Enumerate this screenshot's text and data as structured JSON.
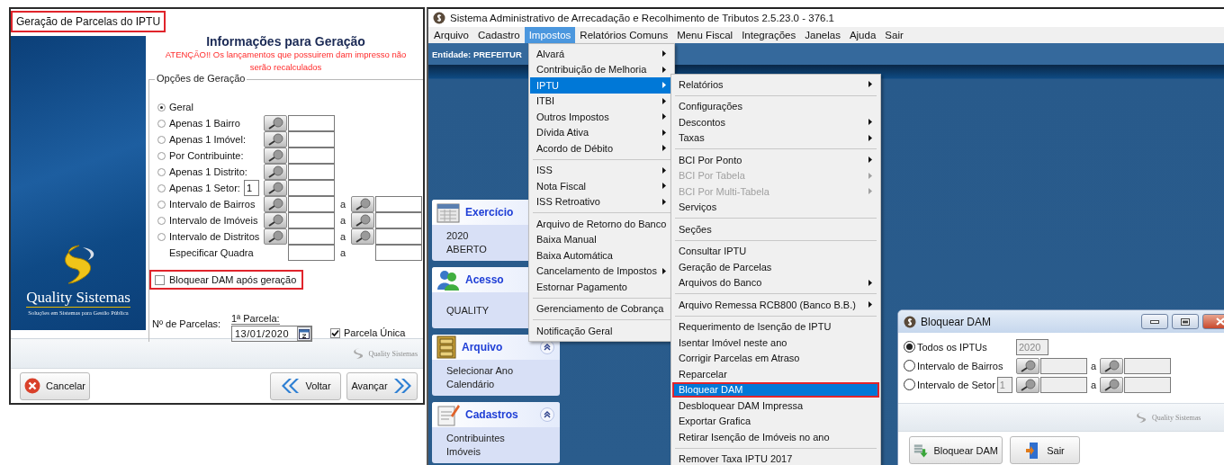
{
  "form_window": {
    "title": "Geração de Parcelas do IPTU",
    "title_annotated": true,
    "brand": "Quality Sistemas",
    "brand_tagline": "Soluções em Sistemas para Gestão Pública",
    "heading": "Informações para Geração",
    "warning": "ATENÇÃO!! Os lançamentos que possuirem dam impresso não serão recalculados",
    "group_title": "Opções de Geração",
    "options": [
      {
        "kind": "plain",
        "label": "Geral",
        "selected": true
      },
      {
        "kind": "single",
        "label": "Apenas 1 Bairro",
        "selected": false
      },
      {
        "kind": "single",
        "label": "Apenas 1 Imóvel:",
        "selected": false
      },
      {
        "kind": "single",
        "label": "Por Contribuinte:",
        "selected": false
      },
      {
        "kind": "single",
        "label": "Apenas 1 Distrito:",
        "selected": false
      },
      {
        "kind": "single",
        "label": "Apenas 1 Setor:",
        "selected": false,
        "prefix": "1"
      },
      {
        "kind": "range",
        "label": "Intervalo de Bairros",
        "selected": false,
        "separator": "a"
      },
      {
        "kind": "range",
        "label": "Intervalo de Imóveis",
        "selected": false,
        "separator": "a"
      },
      {
        "kind": "range",
        "label": "Intervalo de Distritos",
        "selected": false,
        "separator": "a"
      },
      {
        "kind": "fields",
        "label": "Especificar Quadra",
        "separator": "a"
      }
    ],
    "block_option": {
      "label": "Bloquear DAM após geração",
      "checked": false,
      "annotated": true
    },
    "installments_label": "Nº de Parcelas:",
    "first_installment_label": "1ª Parcela:",
    "first_installment_date": "13/01/2020",
    "single_installment": {
      "label": "Parcela Única",
      "checked": true
    },
    "footer_brand": "Quality Sistemas",
    "buttons": [
      {
        "kind": "cancel",
        "label": "Cancelar"
      },
      {
        "kind": "back",
        "label": "Voltar"
      },
      {
        "kind": "next",
        "label": "Avançar"
      }
    ]
  },
  "main_window": {
    "title": "Sistema Administrativo de Arrecadação e Recolhimento de Tributos 2.5.23.0 - 376.1",
    "menu": [
      {
        "label": "Arquivo",
        "selected": false
      },
      {
        "label": "Cadastro",
        "selected": false
      },
      {
        "label": "Impostos",
        "selected": true
      },
      {
        "label": "Relatórios Comuns",
        "selected": false
      },
      {
        "label": "Menu Fiscal",
        "selected": false
      },
      {
        "label": "Integrações",
        "selected": false
      },
      {
        "label": "Janelas",
        "selected": false
      },
      {
        "label": "Ajuda",
        "selected": false
      },
      {
        "label": "Sair",
        "selected": false
      }
    ],
    "entity": "Entidade: PREFEITUR",
    "side_panels": [
      {
        "kind": "calendar",
        "title": "Exercício",
        "lines": [
          "2020",
          "ABERTO"
        ]
      },
      {
        "kind": "user",
        "title": "Acesso",
        "lines": [
          "QUALITY"
        ]
      },
      {
        "kind": "cabinet",
        "title": "Arquivo",
        "collapse_button": true,
        "lines": [
          "Selecionar Ano",
          "Calendário"
        ]
      },
      {
        "kind": "notepad",
        "title": "Cadastros",
        "collapse_button": true,
        "lines": [
          "Contribuintes",
          "Imóveis"
        ]
      }
    ],
    "taxes_menu": [
      {
        "kind": "item",
        "label": "Alvará",
        "submenu": true,
        "selected": false
      },
      {
        "kind": "item",
        "label": "Contribuição de Melhoria",
        "submenu": true,
        "selected": false
      },
      {
        "kind": "item",
        "label": "IPTU",
        "submenu": true,
        "selected": true
      },
      {
        "kind": "item",
        "label": "ITBI",
        "submenu": true,
        "selected": false
      },
      {
        "kind": "item",
        "label": "Outros Impostos",
        "submenu": true,
        "selected": false
      },
      {
        "kind": "item",
        "label": "Dívida Ativa",
        "submenu": true,
        "selected": false
      },
      {
        "kind": "item",
        "label": "Acordo de Débito",
        "submenu": true,
        "selected": false
      },
      {
        "kind": "separator"
      },
      {
        "kind": "item",
        "label": "ISS",
        "submenu": true,
        "selected": false
      },
      {
        "kind": "item",
        "label": "Nota Fiscal",
        "submenu": true,
        "selected": false
      },
      {
        "kind": "item",
        "label": "ISS Retroativo",
        "submenu": true,
        "selected": false
      },
      {
        "kind": "separator"
      },
      {
        "kind": "item",
        "label": "Arquivo de Retorno do Banco",
        "submenu": false,
        "selected": false
      },
      {
        "kind": "item",
        "label": "Baixa Manual",
        "submenu": false,
        "selected": false
      },
      {
        "kind": "item",
        "label": "Baixa Automática",
        "submenu": false,
        "selected": false
      },
      {
        "kind": "item",
        "label": "Cancelamento de Impostos",
        "submenu": true,
        "selected": false
      },
      {
        "kind": "item",
        "label": "Estornar Pagamento",
        "submenu": false,
        "selected": false
      },
      {
        "kind": "separator"
      },
      {
        "kind": "item",
        "label": "Gerenciamento de Cobrança",
        "submenu": false,
        "selected": false
      },
      {
        "kind": "separator"
      },
      {
        "kind": "item",
        "label": "Notificação Geral",
        "submenu": false,
        "selected": false
      }
    ],
    "iptu_menu": [
      {
        "kind": "item",
        "label": "Relatórios",
        "submenu": true,
        "selected": false,
        "disabled": false
      },
      {
        "kind": "separator"
      },
      {
        "kind": "item",
        "label": "Configurações",
        "submenu": false,
        "selected": false,
        "disabled": false
      },
      {
        "kind": "item",
        "label": "Descontos",
        "submenu": true,
        "selected": false,
        "disabled": false
      },
      {
        "kind": "item",
        "label": "Taxas",
        "submenu": true,
        "selected": false,
        "disabled": false
      },
      {
        "kind": "separator"
      },
      {
        "kind": "item",
        "label": "BCI Por Ponto",
        "submenu": true,
        "selected": false,
        "disabled": false
      },
      {
        "kind": "item",
        "label": "BCI Por Tabela",
        "submenu": true,
        "selected": false,
        "disabled": true
      },
      {
        "kind": "item",
        "label": "BCI Por Multi-Tabela",
        "submenu": true,
        "selected": false,
        "disabled": true
      },
      {
        "kind": "item",
        "label": "Serviços",
        "submenu": false,
        "selected": false,
        "disabled": false
      },
      {
        "kind": "separator"
      },
      {
        "kind": "item",
        "label": "Seções",
        "submenu": false,
        "selected": false,
        "disabled": false
      },
      {
        "kind": "separator"
      },
      {
        "kind": "item",
        "label": "Consultar IPTU",
        "submenu": false,
        "selected": false,
        "disabled": false
      },
      {
        "kind": "item",
        "label": "Geração de Parcelas",
        "submenu": false,
        "selected": false,
        "disabled": false
      },
      {
        "kind": "item",
        "label": "Arquivos do Banco",
        "submenu": true,
        "selected": false,
        "disabled": false
      },
      {
        "kind": "separator"
      },
      {
        "kind": "item",
        "label": "Arquivo Remessa RCB800 (Banco B.B.)",
        "submenu": true,
        "selected": false,
        "disabled": false
      },
      {
        "kind": "separator"
      },
      {
        "kind": "item",
        "label": "Requerimento de Isenção de IPTU",
        "submenu": false,
        "selected": false,
        "disabled": false
      },
      {
        "kind": "item",
        "label": "Isentar Imóvel neste ano",
        "submenu": false,
        "selected": false,
        "disabled": false
      },
      {
        "kind": "item",
        "label": "Corrigir Parcelas em Atraso",
        "submenu": false,
        "selected": false,
        "disabled": false
      },
      {
        "kind": "item",
        "label": "Reparcelar",
        "submenu": false,
        "selected": false,
        "disabled": false
      },
      {
        "kind": "item",
        "label": "Bloquear DAM",
        "submenu": false,
        "selected": true,
        "disabled": false,
        "annotated": true
      },
      {
        "kind": "item",
        "label": "Desbloquear DAM Impressa",
        "submenu": false,
        "selected": false,
        "disabled": false
      },
      {
        "kind": "item",
        "label": "Exportar Grafica",
        "submenu": false,
        "selected": false,
        "disabled": false
      },
      {
        "kind": "item",
        "label": "Retirar Isenção de Imóveis no ano",
        "submenu": false,
        "selected": false,
        "disabled": false
      },
      {
        "kind": "separator"
      },
      {
        "kind": "item",
        "label": "Remover Taxa IPTU 2017",
        "submenu": false,
        "selected": false,
        "disabled": false
      }
    ]
  },
  "block_dialog": {
    "title": "Bloquear DAM",
    "options": [
      {
        "kind": "year",
        "label": "Todos os IPTUs",
        "selected": true,
        "value": "2020"
      },
      {
        "kind": "range",
        "label": "Intervalo de Bairros",
        "selected": false,
        "separator": "a"
      },
      {
        "kind": "range",
        "label": "Intervalo de Setor",
        "selected": false,
        "prefix": "1",
        "separator": "a"
      }
    ],
    "footer_brand": "Quality Sistemas",
    "buttons": [
      {
        "kind": "confirm",
        "label": "Bloquear DAM"
      },
      {
        "kind": "exit",
        "label": "Sair"
      }
    ]
  }
}
